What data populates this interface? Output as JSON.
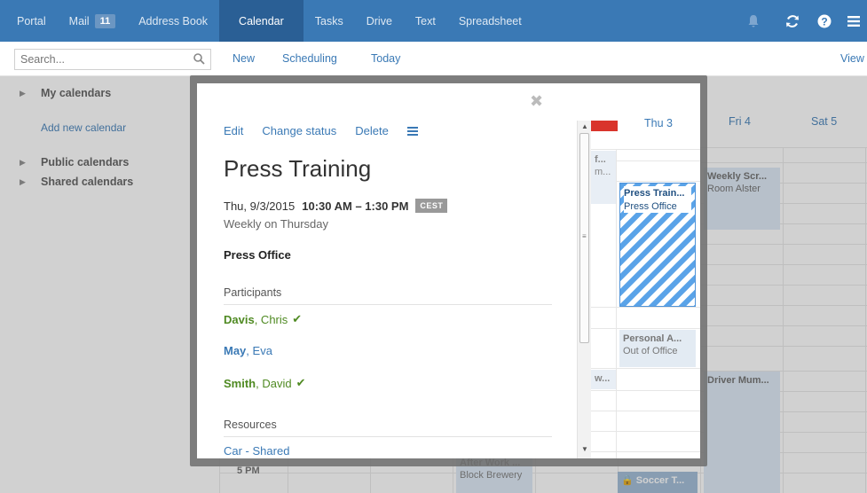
{
  "topnav": {
    "items": [
      {
        "label": "Portal"
      },
      {
        "label": "Mail",
        "badge": "11"
      },
      {
        "label": "Address Book"
      },
      {
        "label": "Calendar",
        "active": true
      },
      {
        "label": "Tasks"
      },
      {
        "label": "Drive"
      },
      {
        "label": "Text"
      },
      {
        "label": "Spreadsheet"
      }
    ],
    "icons": [
      "bell-icon",
      "refresh-icon",
      "help-icon",
      "menu-icon"
    ]
  },
  "toolbar": {
    "search_placeholder": "Search...",
    "new_label": "New",
    "scheduling_label": "Scheduling",
    "today_label": "Today",
    "view_label": "View"
  },
  "sidebar": {
    "my_calendars": "My calendars",
    "add_new_calendar": "Add new calendar",
    "public_calendars": "Public calendars",
    "shared_calendars": "Shared calendars"
  },
  "calendar": {
    "days": [
      "Thu 3",
      "Fri 4",
      "Sat 5"
    ],
    "time_label": "5 PM",
    "events": [
      {
        "title": "Press Train...",
        "subtitle": "Press Office"
      },
      {
        "title": "Personal A...",
        "subtitle": "Out of Office"
      },
      {
        "title": "Weekly Scr...",
        "subtitle": "Room Alster"
      },
      {
        "title": "Driver Mum...",
        "subtitle": ""
      },
      {
        "title": "After Work ...",
        "subtitle": "Block Brewery"
      },
      {
        "title": "Soccer T...",
        "subtitle": ""
      },
      {
        "title": "f...",
        "subtitle": "m..."
      },
      {
        "title": "w...",
        "subtitle": ""
      }
    ]
  },
  "popup": {
    "actions": {
      "edit": "Edit",
      "change_status": "Change status",
      "delete": "Delete"
    },
    "title": "Press Training",
    "date": "Thu, 9/3/2015",
    "time": "10:30 AM – 1:30 PM",
    "timezone": "CEST",
    "recurrence": "Weekly on Thursday",
    "location": "Press Office",
    "participants_heading": "Participants",
    "participants": [
      {
        "last": "Davis",
        "first": ", Chris",
        "status": "accepted"
      },
      {
        "last": "May",
        "first": ", Eva",
        "status": "none"
      },
      {
        "last": "Smith",
        "first": ", David",
        "status": "accepted"
      }
    ],
    "resources_heading": "Resources",
    "resources": [
      "Car - Shared"
    ]
  },
  "colors": {
    "topbar": "#3a79b5",
    "active_tab": "#2a5f95",
    "link": "#3a79b5",
    "accepted": "#4f8a22",
    "event_stripe_a": "#5aa3e8",
    "event_stripe_b": "#ffffff"
  }
}
